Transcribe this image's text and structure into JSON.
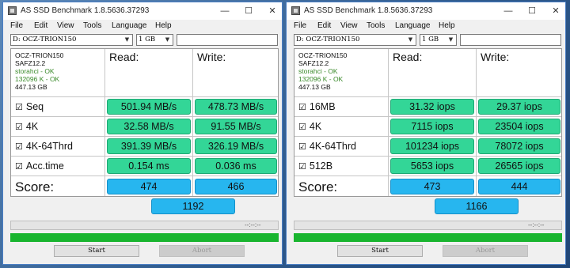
{
  "window_title": "AS SSD Benchmark 1.8.5636.37293",
  "menu": [
    "File",
    "Edit",
    "View",
    "Tools",
    "Language",
    "Help"
  ],
  "title_controls": {
    "minimize": "—",
    "maximize": "☐",
    "close": "✕"
  },
  "icons": {
    "app": "app-icon",
    "dropdown": "chevron-down-icon",
    "checkbox": "checked-checkbox-icon"
  },
  "colors": {
    "value_fill": "#33d697",
    "score_fill": "#27b6ef",
    "progress": "#19b52f"
  },
  "left": {
    "drive": "D: OCZ-TRION150",
    "size": "1 GB",
    "info": {
      "model": "OCZ-TRION150",
      "firmware": "SAFZ12.2",
      "driver": "storahci - OK",
      "alignment": "132096 K - OK",
      "capacity": "447.13 GB"
    },
    "read_header": "Read:",
    "write_header": "Write:",
    "rows": [
      {
        "check": "☑",
        "label": "Seq",
        "read": "501.94 MB/s",
        "write": "478.73 MB/s"
      },
      {
        "check": "☑",
        "label": "4K",
        "read": "32.58 MB/s",
        "write": "91.55 MB/s"
      },
      {
        "check": "☑",
        "label": "4K-64Thrd",
        "read": "391.39 MB/s",
        "write": "326.19 MB/s"
      },
      {
        "check": "☑",
        "label": "Acc.time",
        "read": "0.154 ms",
        "write": "0.036 ms"
      }
    ],
    "score_label": "Score:",
    "score_read": "474",
    "score_write": "466",
    "score_total": "1192",
    "time": "--:--:--",
    "progress_percent": 100,
    "start_label": "Start",
    "abort_label": "Abort"
  },
  "right": {
    "drive": "D: OCZ-TRION150",
    "size": "1 GB",
    "info": {
      "model": "OCZ-TRION150",
      "firmware": "SAFZ12.2",
      "driver": "storahci - OK",
      "alignment": "132096 K - OK",
      "capacity": "447.13 GB"
    },
    "read_header": "Read:",
    "write_header": "Write:",
    "rows": [
      {
        "check": "☑",
        "label": "16MB",
        "read": "31.32 iops",
        "write": "29.37 iops"
      },
      {
        "check": "☑",
        "label": "4K",
        "read": "7115 iops",
        "write": "23504 iops"
      },
      {
        "check": "☑",
        "label": "4K-64Thrd",
        "read": "101234 iops",
        "write": "78072 iops"
      },
      {
        "check": "☑",
        "label": "512B",
        "read": "5653 iops",
        "write": "26565 iops"
      }
    ],
    "score_label": "Score:",
    "score_read": "473",
    "score_write": "444",
    "score_total": "1166",
    "time": "--:--:--",
    "progress_percent": 100,
    "start_label": "Start",
    "abort_label": "Abort"
  }
}
